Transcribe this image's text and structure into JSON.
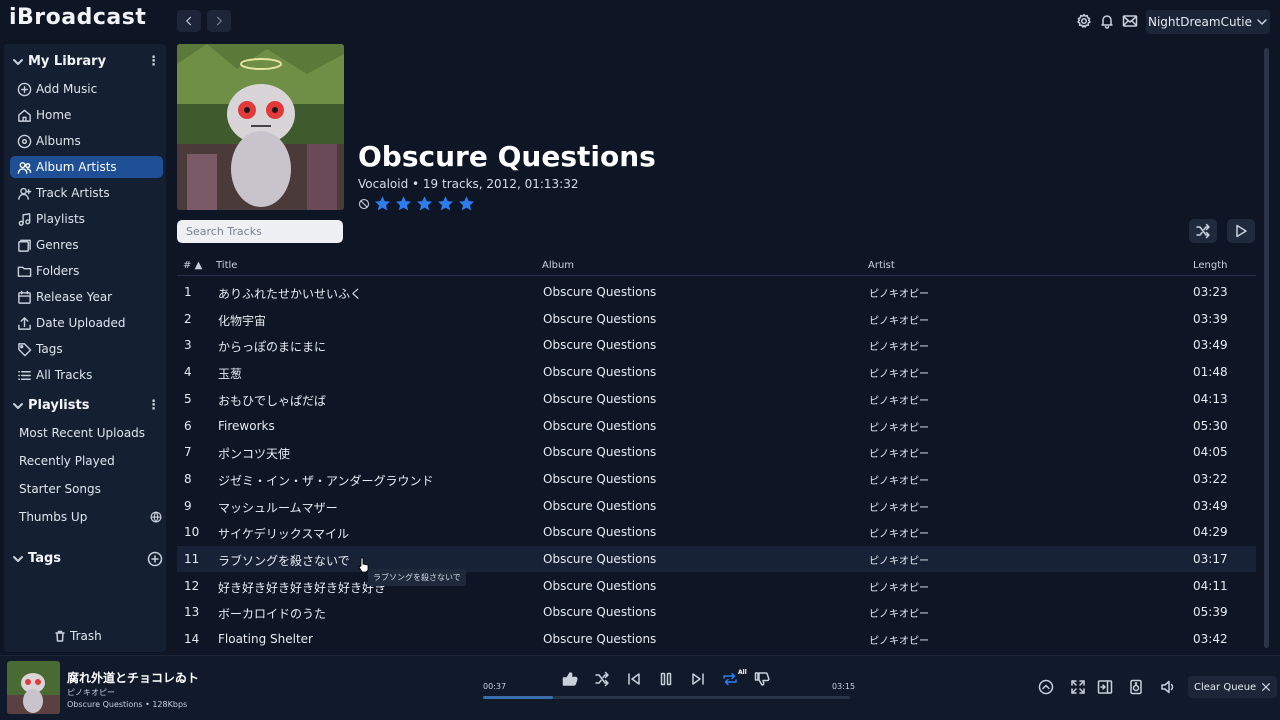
{
  "app": {
    "logo": "iBroadcast",
    "username": "NightDreamCutie"
  },
  "sidebar": {
    "library_title": "My Library",
    "library_items": [
      {
        "label": "Add Music",
        "icon": "plus-circle-icon"
      },
      {
        "label": "Home",
        "icon": "home-icon"
      },
      {
        "label": "Albums",
        "icon": "disc-icon"
      },
      {
        "label": "Album Artists",
        "icon": "users-icon",
        "active": true
      },
      {
        "label": "Track Artists",
        "icon": "user-icon"
      },
      {
        "label": "Playlists",
        "icon": "music-note-icon"
      },
      {
        "label": "Genres",
        "icon": "genres-icon"
      },
      {
        "label": "Folders",
        "icon": "folder-icon"
      },
      {
        "label": "Release Year",
        "icon": "calendar-icon"
      },
      {
        "label": "Date Uploaded",
        "icon": "upload-icon"
      },
      {
        "label": "Tags",
        "icon": "tag-icon"
      },
      {
        "label": "All Tracks",
        "icon": "list-icon"
      }
    ],
    "playlists_title": "Playlists",
    "playlists": [
      "Most Recent Uploads",
      "Recently Played",
      "Starter Songs",
      "Thumbs Up"
    ],
    "tags_title": "Tags",
    "trash_label": "Trash"
  },
  "album": {
    "title": "Obscure Questions",
    "meta": "Vocaloid • 19 tracks, 2012, 01:13:32",
    "rating": 5,
    "search_placeholder": "Search Tracks"
  },
  "table": {
    "headers": {
      "num": "#",
      "title": "Title",
      "album": "Album",
      "artist": "Artist",
      "length": "Length"
    },
    "rows": [
      {
        "num": "1",
        "title": "ありふれたせかいせいふく",
        "album": "Obscure Questions",
        "artist": "ピノキオピー",
        "length": "03:23"
      },
      {
        "num": "2",
        "title": "化物宇宙",
        "album": "Obscure Questions",
        "artist": "ピノキオピー",
        "length": "03:39"
      },
      {
        "num": "3",
        "title": "からっぽのまにまに",
        "album": "Obscure Questions",
        "artist": "ピノキオピー",
        "length": "03:49"
      },
      {
        "num": "4",
        "title": "玉葱",
        "album": "Obscure Questions",
        "artist": "ピノキオピー",
        "length": "01:48"
      },
      {
        "num": "5",
        "title": "おもひでしゃぱだば",
        "album": "Obscure Questions",
        "artist": "ピノキオピー",
        "length": "04:13"
      },
      {
        "num": "6",
        "title": "Fireworks",
        "album": "Obscure Questions",
        "artist": "ピノキオピー",
        "length": "05:30"
      },
      {
        "num": "7",
        "title": "ポンコツ天使",
        "album": "Obscure Questions",
        "artist": "ピノキオピー",
        "length": "04:05"
      },
      {
        "num": "8",
        "title": "ジゼミ・イン・ザ・アンダーグラウンド",
        "album": "Obscure Questions",
        "artist": "ピノキオピー",
        "length": "03:22"
      },
      {
        "num": "9",
        "title": "マッシュルームマザー",
        "album": "Obscure Questions",
        "artist": "ピノキオピー",
        "length": "03:49"
      },
      {
        "num": "10",
        "title": "サイケデリックスマイル",
        "album": "Obscure Questions",
        "artist": "ピノキオピー",
        "length": "04:29"
      },
      {
        "num": "11",
        "title": "ラブソングを殺さないで",
        "album": "Obscure Questions",
        "artist": "ピノキオピー",
        "length": "03:17"
      },
      {
        "num": "12",
        "title": "好き好き好き好き好き好き好き",
        "album": "Obscure Questions",
        "artist": "ピノキオピー",
        "length": "04:11"
      },
      {
        "num": "13",
        "title": "ボーカロイドのうた",
        "album": "Obscure Questions",
        "artist": "ピノキオピー",
        "length": "05:39"
      },
      {
        "num": "14",
        "title": "Floating Shelter",
        "album": "Obscure Questions",
        "artist": "ピノキオピー",
        "length": "03:42"
      }
    ],
    "tooltip": "ラブソングを殺さないで"
  },
  "player": {
    "track_title": "腐れ外道とチョコレゐト",
    "artist": "ピノキオピー",
    "album_info": "Obscure Questions • 128Kbps",
    "elapsed": "00:37",
    "total": "03:15",
    "progress": 0.19,
    "repeat_label": "All",
    "clear_queue": "Clear Queue"
  },
  "colors": {
    "accent": "#2d7df0",
    "active_nav": "#1f4f94",
    "background": "#0e1626"
  }
}
